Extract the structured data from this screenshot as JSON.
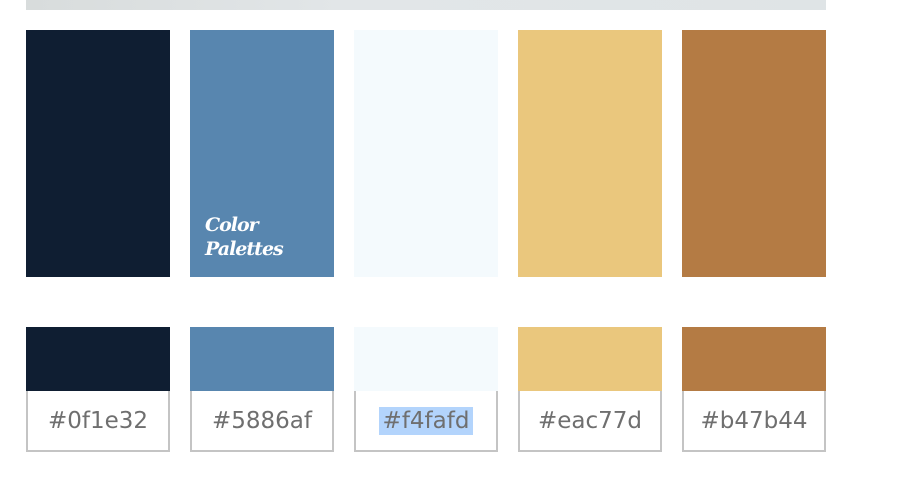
{
  "logo_text": [
    "Color",
    "Palettes"
  ],
  "swatches": [
    {
      "color": "#0f1e32",
      "hex": "#0f1e32"
    },
    {
      "color": "#5886af",
      "hex": "#5886af"
    },
    {
      "color": "#f4fafd",
      "hex": "#f4fafd",
      "selected": true
    },
    {
      "color": "#eac77d",
      "hex": "#eac77d"
    },
    {
      "color": "#b47b44",
      "hex": "#b47b44"
    }
  ],
  "selection_color": "#b3d4fc"
}
